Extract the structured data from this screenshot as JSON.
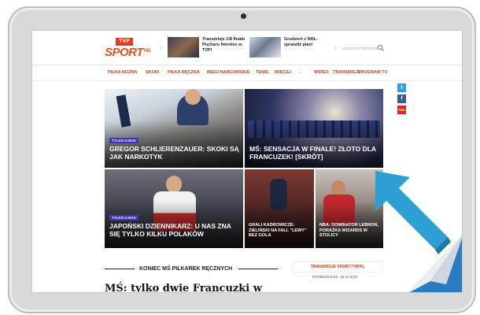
{
  "header": {
    "logo_tvp": "TVP",
    "logo_sport": "SPORT",
    "logo_hd": "HD",
    "news": [
      {
        "text": "Transmisje 1/8 finału Pucharu Niemiec w TVP!"
      },
      {
        "text": "Grudzień z NHL: sprawdź plan!"
      }
    ],
    "search_placeholder": "SZUKAJ W SERWISIE"
  },
  "nav": {
    "items": [
      "PIŁKA NOŻNA",
      "SKOKI",
      "PIŁKA RĘCZNA",
      "BIEGI NARCIARSKIE",
      "TENIS",
      "WIĘCEJ"
    ],
    "right_items": [
      "WIDEO",
      "TRANSMISJE",
      "PROGRAM TV"
    ]
  },
  "social": {
    "twitter": "t",
    "facebook": "f",
    "youtube": "You"
  },
  "tiles": [
    {
      "badge": "TYLKO U NAS",
      "headline": "GREGOR SCHLIERENZAUER: SKOKI SĄ JAK NARKOTYK"
    },
    {
      "badge": "",
      "headline": "MŚ: SENSACJA W FINALE! ZŁOTO DLA FRANCUZEK! [SKRÓT]"
    },
    {
      "badge": "TYLKO U NAS",
      "headline": "JAPOŃSKI DZIENNIKARZ: U NAS ZNA SIĘ TYLKO KILKU POLAKÓW"
    },
    {
      "badge": "",
      "headline": "GRALI KADROWICZE: ZIELIŃSKI NA FALI, \"LEWY\" BEZ GOLA"
    },
    {
      "badge": "",
      "headline": "NBA: DOMINATOR LEBRON, PORAŻKA WIZARDS W STOLICY"
    }
  ],
  "section": {
    "title": "KONIEC MŚ PIŁKAREK RĘCZNYCH",
    "transmisje": "TRANSMISJE SPORT.TVP.PL",
    "date": "PONIEDZIAŁEK, 18.12.2017",
    "big_headline": "MŚ: tylko dwie Francuzki w"
  },
  "overlay": {
    "close": "×"
  },
  "colors": {
    "brand": "#e8501e",
    "nav": "#d23c1a",
    "badge": "#3c35c8",
    "arrow": "#2e9fd2"
  }
}
